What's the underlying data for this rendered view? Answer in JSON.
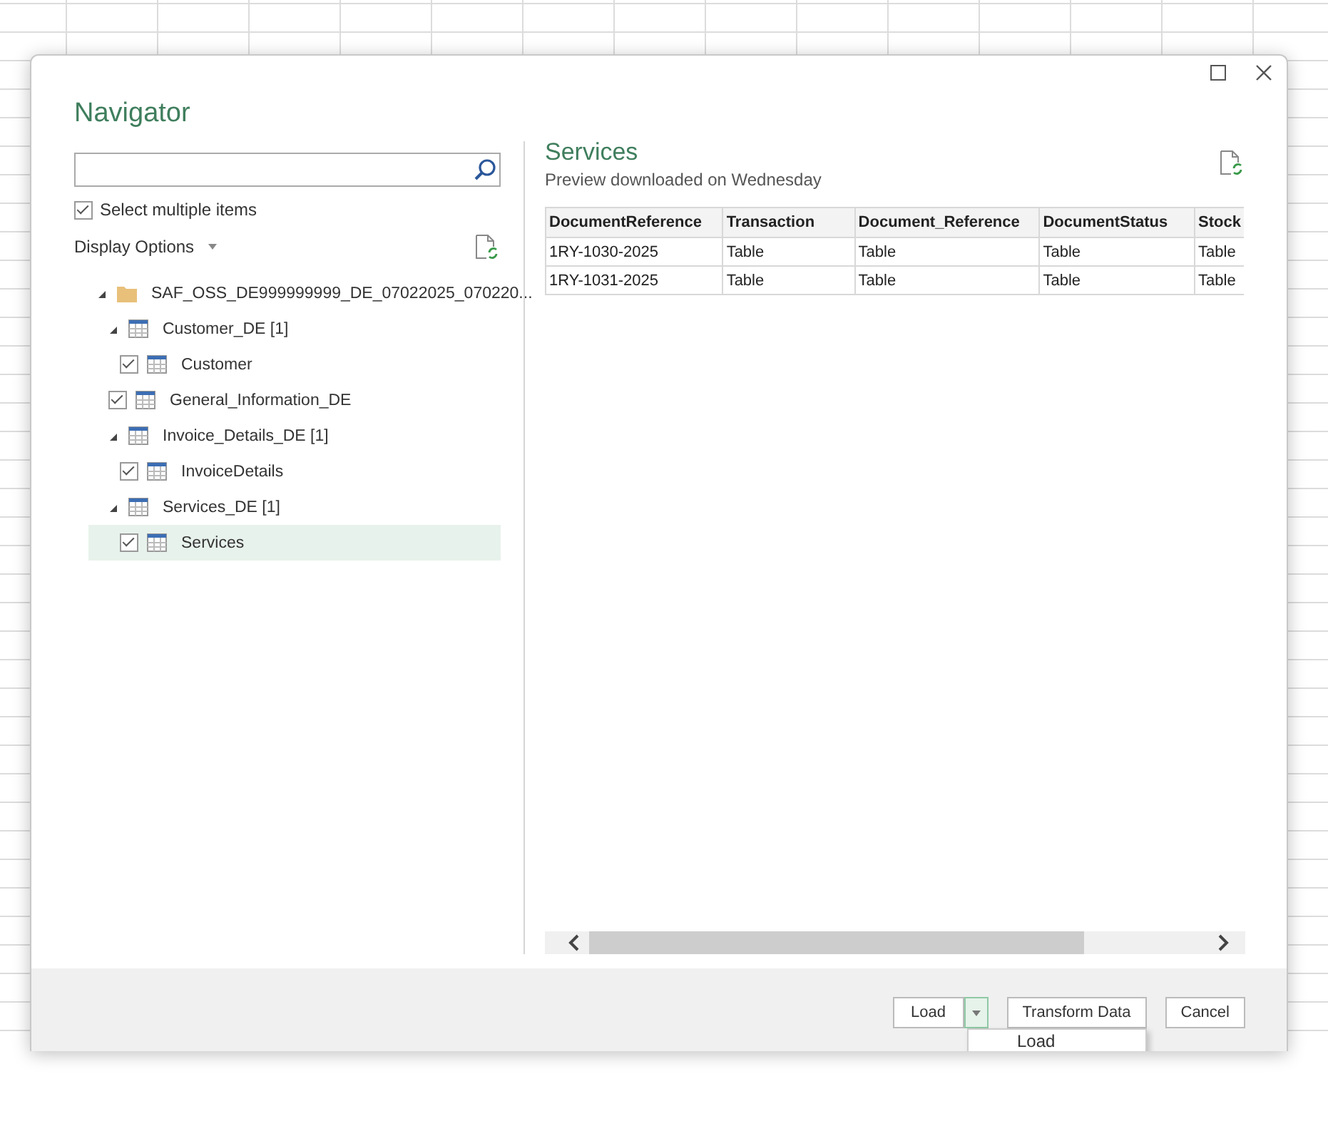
{
  "window": {
    "title": "Navigator"
  },
  "select_multiple": {
    "label": "Select multiple items",
    "checked": true
  },
  "display_options": {
    "label": "Display Options"
  },
  "tree": [
    {
      "label": "SAF_OSS_DE999999999_DE_07022025_070220...",
      "kind": "folder",
      "expanded": true,
      "selected": false,
      "children": [
        {
          "label": "Customer_DE [1]",
          "kind": "table",
          "expanded": true,
          "selected": false,
          "children": [
            {
              "label": "Customer",
              "kind": "table",
              "checked": true,
              "selected": false
            }
          ]
        },
        {
          "label": "General_Information_DE",
          "kind": "table",
          "checked": true,
          "selected": false
        },
        {
          "label": "Invoice_Details_DE [1]",
          "kind": "table",
          "expanded": true,
          "selected": false,
          "children": [
            {
              "label": "InvoiceDetails",
              "kind": "table",
              "checked": true,
              "selected": false
            }
          ]
        },
        {
          "label": "Services_DE [1]",
          "kind": "table",
          "expanded": true,
          "selected": false,
          "children": [
            {
              "label": "Services",
              "kind": "table",
              "checked": true,
              "selected": true
            }
          ]
        }
      ]
    }
  ],
  "preview": {
    "title": "Services",
    "subtitle": "Preview downloaded on Wednesday",
    "table": {
      "columns": [
        "DocumentReference",
        "Transaction",
        "Document_Reference",
        "DocumentStatus",
        "Stock"
      ],
      "rows": [
        [
          "1RY-1030-2025",
          "Table",
          "Table",
          "Table",
          "Table"
        ],
        [
          "1RY-1031-2025",
          "Table",
          "Table",
          "Table",
          "Table"
        ]
      ]
    }
  },
  "buttons": [
    {
      "label": "Load",
      "kind": "split"
    },
    {
      "label": "Transform Data",
      "kind": "plain"
    },
    {
      "label": "Cancel",
      "kind": "plain"
    }
  ],
  "load_menu": {
    "items": [
      "Load"
    ]
  }
}
